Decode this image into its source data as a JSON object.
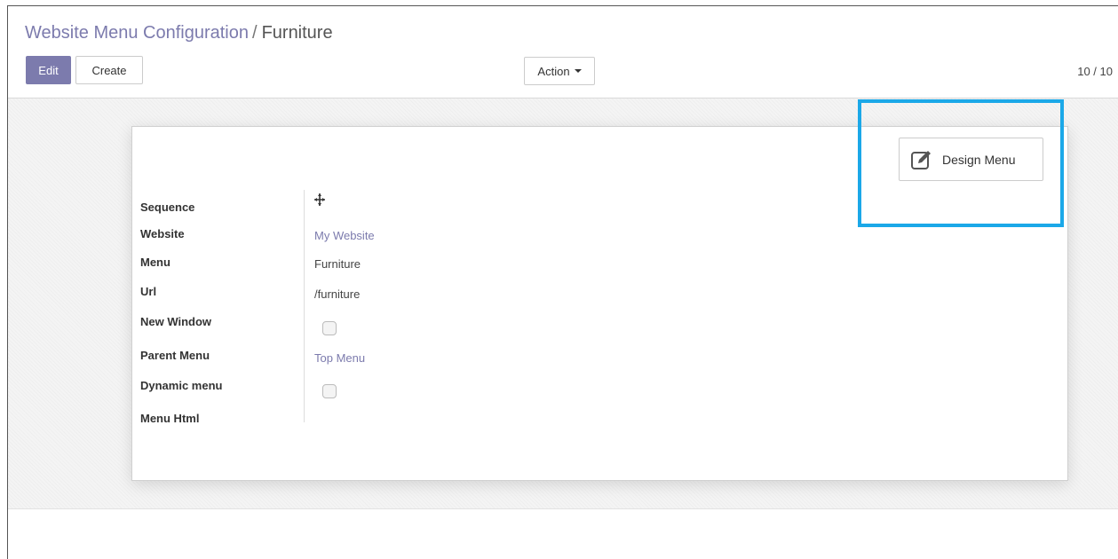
{
  "breadcrumb": {
    "parent": "Website Menu Configuration",
    "separator": "/",
    "current": "Furniture"
  },
  "toolbar": {
    "edit_label": "Edit",
    "create_label": "Create",
    "action_label": "Action"
  },
  "pager": {
    "value": "10 / 10"
  },
  "design_button": {
    "label": "Design Menu",
    "icon": "edit-icon"
  },
  "form": {
    "labels": {
      "sequence": "Sequence",
      "website": "Website",
      "menu": "Menu",
      "url": "Url",
      "new_window": "New Window",
      "parent_menu": "Parent Menu",
      "dynamic_menu": "Dynamic menu",
      "menu_html": "Menu Html"
    },
    "values": {
      "sequence_icon": "drag-handle-icon",
      "website": "My Website",
      "menu": "Furniture",
      "url": "/furniture",
      "new_window": false,
      "parent_menu": "Top Menu",
      "dynamic_menu": false
    }
  },
  "colors": {
    "primary": "#7c7bad",
    "highlight": "#1ba8e8"
  }
}
